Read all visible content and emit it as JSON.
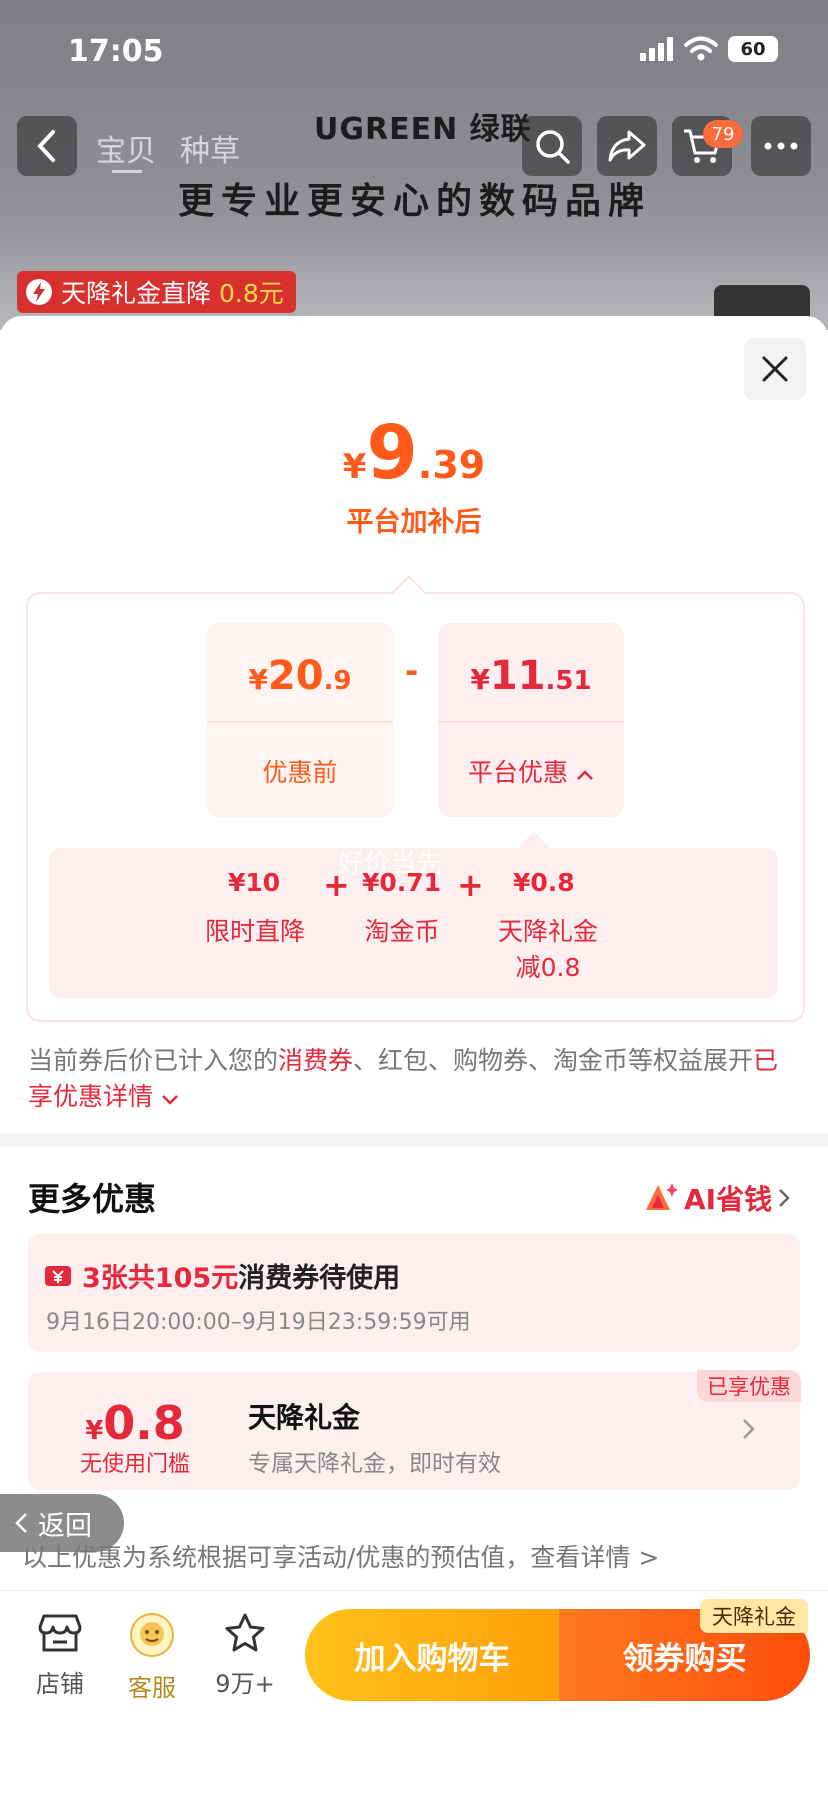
{
  "status_bar": {
    "time": "17:05",
    "battery": "60"
  },
  "nav": {
    "tabs": [
      "宝贝",
      "种草"
    ],
    "cart_count": "79"
  },
  "banner": {
    "brand": "UGREEN 绿联",
    "slogan": "更专业更安心的数码品牌"
  },
  "gift_banner": {
    "text": "天降礼金直降",
    "amount": "0.8元"
  },
  "price": {
    "currency": "¥",
    "integer": "9",
    "decimal": ".39",
    "caption": "平台加补后"
  },
  "calc": {
    "before": {
      "currency": "¥",
      "integer": "20",
      "decimal": ".9",
      "label": "优惠前"
    },
    "operator": "-",
    "platform": {
      "currency": "¥",
      "integer": "11",
      "decimal": ".51",
      "label": "平台优惠"
    },
    "details": [
      {
        "value": "¥10",
        "label": "限时直降"
      },
      {
        "value": "¥0.71",
        "label": "淘金币"
      },
      {
        "value": "¥0.8",
        "label": "天降礼金",
        "sub": "减0.8"
      }
    ],
    "plus": "+",
    "watermark": "好价当先"
  },
  "note": {
    "part1": "当前券后价已计入您的",
    "link1": "消费券",
    "part2": "、红包、购物券、淘金币等权益展开",
    "link2": "已享优惠详情"
  },
  "more": {
    "title": "更多优惠",
    "ai_label": "AI省钱",
    "coupon": {
      "highlight": "3张共105元",
      "text": "消费券待使用",
      "period": "9月16日20:00:00–9月19日23:59:59可用"
    },
    "gift": {
      "badge": "已享优惠",
      "currency": "¥",
      "amount": "0.8",
      "condition": "无使用门槛",
      "title": "天降礼金",
      "desc": "专属天降礼金，即时有效"
    }
  },
  "back_label": "返回",
  "disclaimer": "以上优惠为系统根据可享活动/优惠的预估值，查看详情 >",
  "bottom": {
    "store": "店铺",
    "service": "客服",
    "favorites": "9万+",
    "add_cart": "加入购物车",
    "buy": "领券购买",
    "buy_tag": "天降礼金"
  },
  "colors": {
    "accent_orange": "#ff5a1a",
    "accent_red": "#e5293b",
    "cart_yellow": "#ffc11a"
  }
}
